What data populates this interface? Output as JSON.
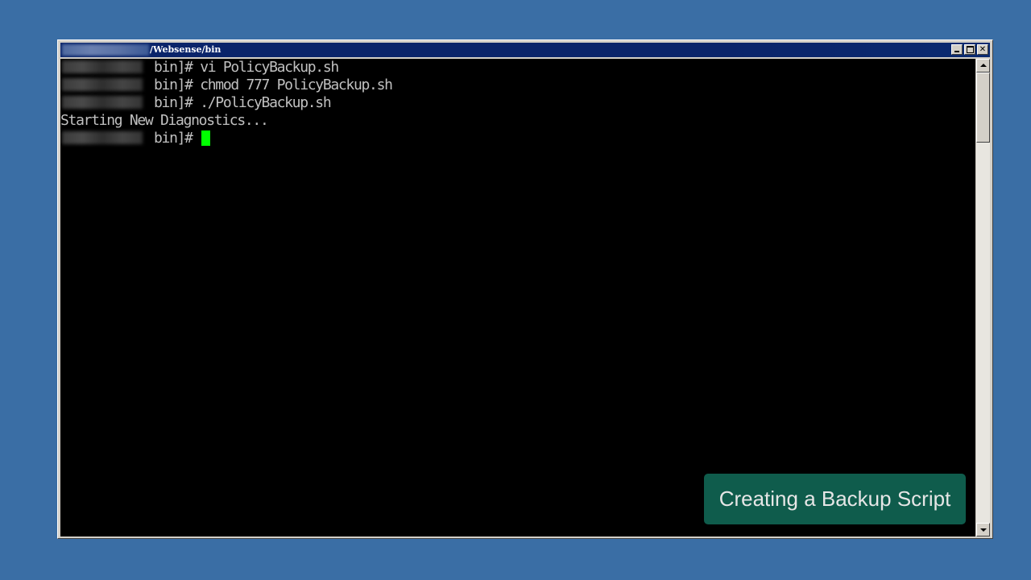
{
  "window": {
    "title": "/Websense/bin",
    "buttons": {
      "minimize": "minimize-icon",
      "maximize": "maximize-icon",
      "close": "✕"
    }
  },
  "terminal": {
    "lines": [
      {
        "prompt": "bin]#",
        "command": "vi PolicyBackup.sh"
      },
      {
        "prompt": "bin]#",
        "command": "chmod 777 PolicyBackup.sh"
      },
      {
        "prompt": "bin]#",
        "command": "./PolicyBackup.sh"
      },
      {
        "output": "Starting New Diagnostics..."
      },
      {
        "prompt": "bin]#",
        "command": ""
      }
    ],
    "cursor_color": "#00ff00"
  },
  "caption": {
    "text": "Creating a Backup Script"
  },
  "colors": {
    "desktop": "#3a6ea5",
    "titlebar": "#0a246a",
    "terminal_bg": "#000000",
    "terminal_fg": "#c0c0c0",
    "caption_bg": "#0f5c4c"
  }
}
